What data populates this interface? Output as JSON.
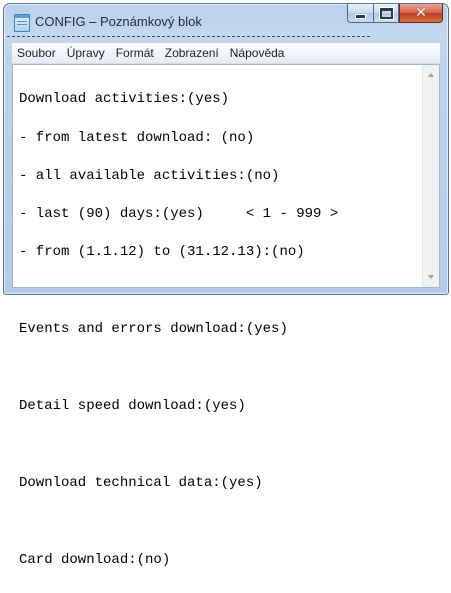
{
  "window": {
    "title": "CONFIG – Poznámkový blok",
    "buttons": {
      "minimize_icon": "minimize-icon",
      "maximize_icon": "maximize-icon",
      "close_icon": "close-icon",
      "close_glyph": "✕"
    },
    "colors": {
      "close_button": "#c7412a",
      "frame": "#b9d1ea"
    }
  },
  "menu": {
    "items": [
      "Soubor",
      "Úpravy",
      "Formát",
      "Zobrazení",
      "Nápověda"
    ]
  },
  "editor": {
    "lines": [
      "Download activities:(yes)",
      "- from latest download: (no)",
      "- all available activities:(no)",
      "- last (90) days:(yes)     < 1 - 999 >",
      "- from (1.1.12) to (31.12.13):(no)",
      "",
      "Events and errors download:(yes)",
      "",
      "Detail speed download:(yes)",
      "",
      "Download technical data:(yes)",
      "",
      "Card download:(no)"
    ]
  }
}
